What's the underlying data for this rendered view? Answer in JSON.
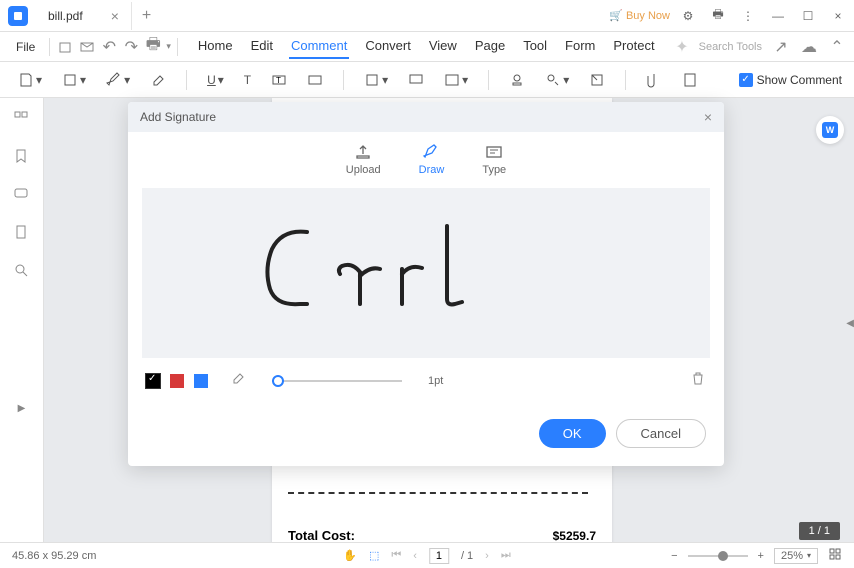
{
  "tab": {
    "filename": "bill.pdf"
  },
  "titlebar": {
    "buynow": "Buy Now"
  },
  "menu": {
    "file": "File",
    "tabs": [
      "Home",
      "Edit",
      "Comment",
      "Convert",
      "View",
      "Page",
      "Tool",
      "Form",
      "Protect"
    ],
    "active_index": 2,
    "search_placeholder": "Search Tools"
  },
  "toolbar": {
    "show_comment": "Show Comment"
  },
  "modal": {
    "title": "Add Signature",
    "tabs": {
      "upload": "Upload",
      "draw": "Draw",
      "type": "Type"
    },
    "active_tab": "draw",
    "signature_text": "Carl",
    "stroke_width": "1pt",
    "colors": {
      "black": "#000000",
      "red": "#d63939",
      "blue": "#2a7fff"
    },
    "selected_color": "black",
    "ok": "OK",
    "cancel": "Cancel"
  },
  "document": {
    "total_label": "Total Cost:",
    "total_value": "$5259.7"
  },
  "page_indicator": "1 / 1",
  "statusbar": {
    "cursor_pos": "45.86 x 95.29 cm",
    "current_page": "1",
    "total_pages": "/ 1",
    "zoom": "25%"
  }
}
